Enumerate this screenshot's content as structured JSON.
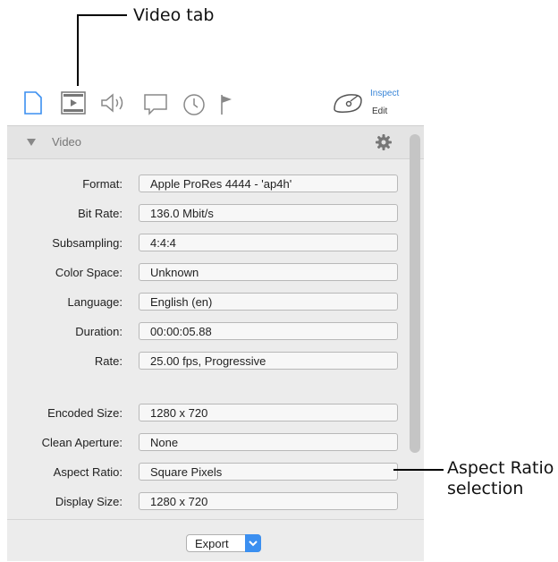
{
  "callouts": {
    "video_tab": "Video tab",
    "aspect_ratio_line1": "Aspect Ratio",
    "aspect_ratio_line2": "selection"
  },
  "toolbar": {
    "tabs": [
      {
        "name": "general-tab-icon",
        "icon": "document"
      },
      {
        "name": "video-tab-icon",
        "icon": "film-frame"
      },
      {
        "name": "audio-tab-icon",
        "icon": "speaker"
      },
      {
        "name": "captions-tab-icon",
        "icon": "speech-bubble"
      },
      {
        "name": "timecode-tab-icon",
        "icon": "clock"
      },
      {
        "name": "markers-tab-icon",
        "icon": "flag"
      }
    ],
    "inspect_label": "Inspect",
    "edit_label": "Edit",
    "accent_color": "#3a86d8"
  },
  "section": {
    "title": "Video"
  },
  "rows": [
    {
      "label": "Format:",
      "value": "Apple ProRes 4444 - 'ap4h'"
    },
    {
      "label": "Bit Rate:",
      "value": "136.0 Mbit/s"
    },
    {
      "label": "Subsampling:",
      "value": "4:4:4"
    },
    {
      "label": "Color Space:",
      "value": "Unknown"
    },
    {
      "label": "Language:",
      "value": "English (en)"
    },
    {
      "label": "Duration:",
      "value": "00:00:05.88"
    },
    {
      "label": "Rate:",
      "value": "25.00 fps, Progressive"
    },
    {
      "label": "Encoded Size:",
      "value": "1280 x 720"
    },
    {
      "label": "Clean Aperture:",
      "value": "None"
    },
    {
      "label": "Aspect Ratio:",
      "value": "Square Pixels"
    },
    {
      "label": "Display Size:",
      "value": "1280 x 720"
    }
  ],
  "footer": {
    "export_label": "Export"
  }
}
